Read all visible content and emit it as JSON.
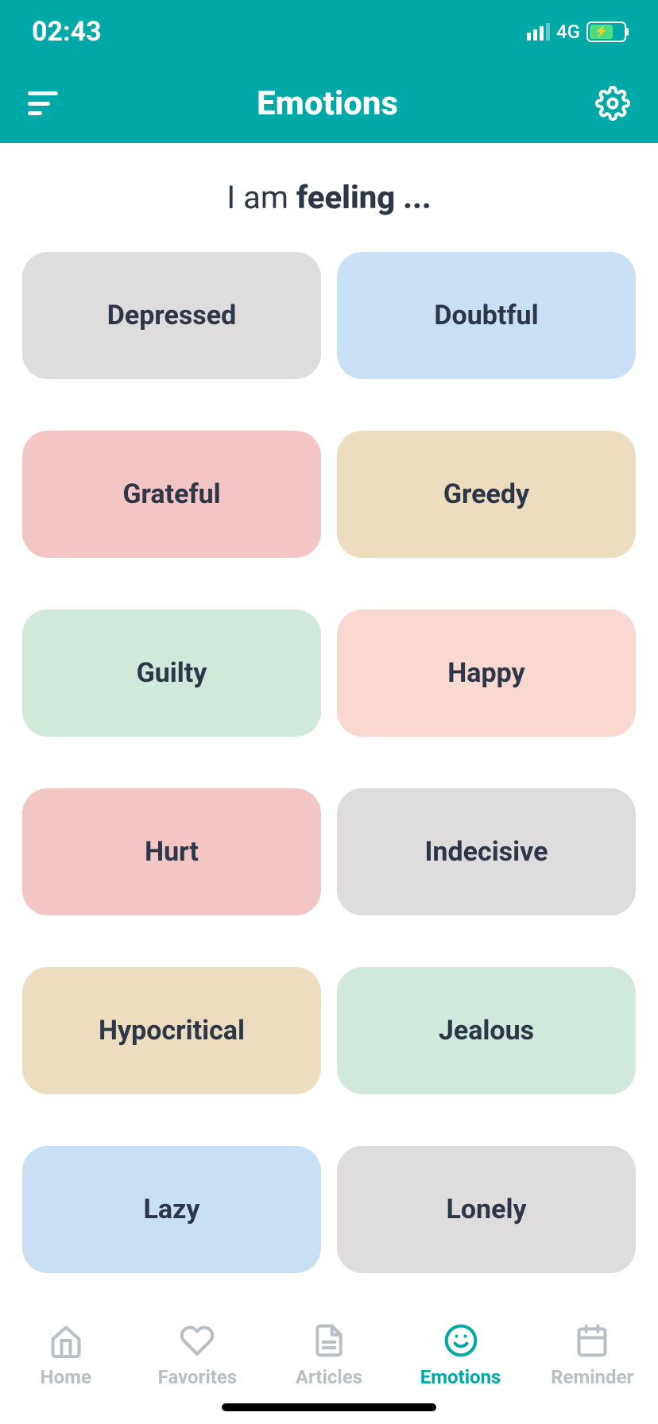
{
  "statusBar": {
    "time": "02:43",
    "network": "4G"
  },
  "header": {
    "title": "Emotions"
  },
  "prompt": {
    "prefix": "I am ",
    "bold": "feeling ..."
  },
  "emotions": [
    {
      "label": "Depressed",
      "color": "#dfdcde"
    },
    {
      "label": "Doubtful",
      "color": "#c9dff4"
    },
    {
      "label": "Grateful",
      "color": "#f4c5c5"
    },
    {
      "label": "Greedy",
      "color": "#ecddc1"
    },
    {
      "label": "Guilty",
      "color": "#d0e9db"
    },
    {
      "label": "Happy",
      "color": "#fad8d2"
    },
    {
      "label": "Hurt",
      "color": "#f4c5c5"
    },
    {
      "label": "Indecisive",
      "color": "#dfdcde"
    },
    {
      "label": "Hypocritical",
      "color": "#ecddc1"
    },
    {
      "label": "Jealous",
      "color": "#d0e9db"
    },
    {
      "label": "Lazy",
      "color": "#c9dff4"
    },
    {
      "label": "Lonely",
      "color": "#dfdcde"
    }
  ],
  "bottomNav": {
    "items": [
      {
        "label": "Home",
        "icon": "home",
        "active": false
      },
      {
        "label": "Favorites",
        "icon": "heart",
        "active": false
      },
      {
        "label": "Articles",
        "icon": "document",
        "active": false
      },
      {
        "label": "Emotions",
        "icon": "smile",
        "active": true
      },
      {
        "label": "Reminder",
        "icon": "calendar",
        "active": false
      }
    ]
  }
}
